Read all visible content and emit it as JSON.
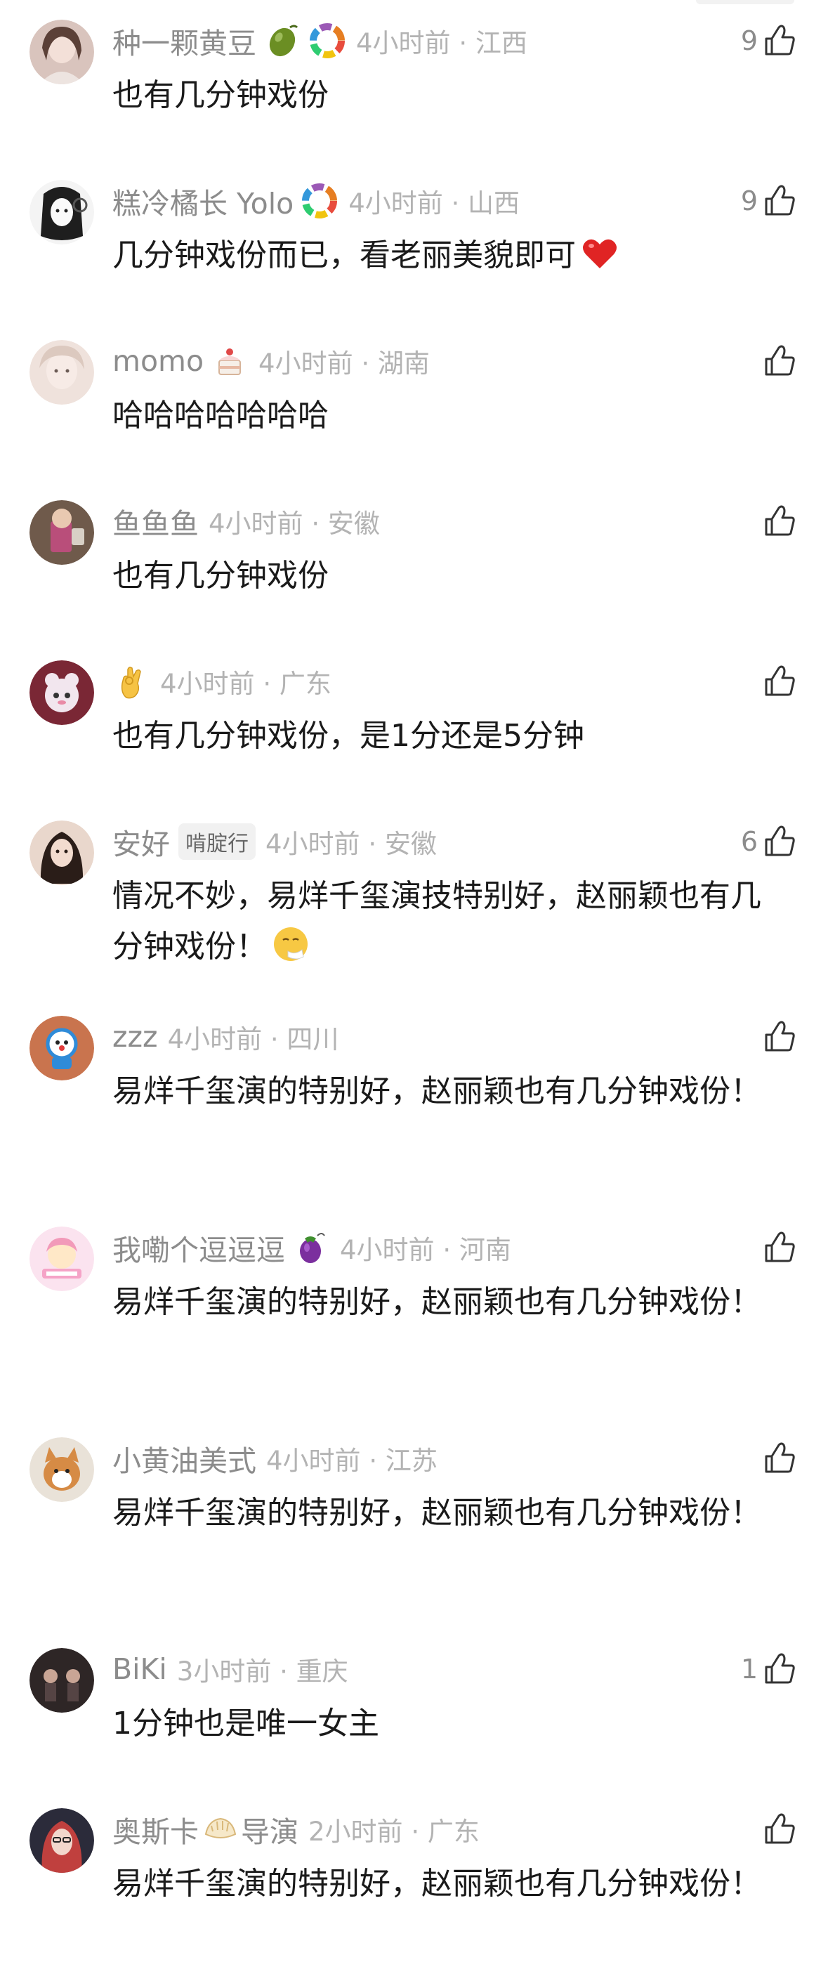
{
  "comments": [
    {
      "username": "种一颗黄豆",
      "badges": [
        "olive-icon",
        "colorful-ring-icon"
      ],
      "time": "4小时前",
      "location": "江西",
      "likes": "9",
      "text": "也有几分钟戏份",
      "avatar_color": "#d9c4bd"
    },
    {
      "username": "糕冷橘长 Yolo",
      "badges": [
        "colorful-ring-icon"
      ],
      "time": "4小时前",
      "location": "山西",
      "likes": "9",
      "text": "几分钟戏份而已，看老丽美貌即可",
      "text_emoji": "red-heart-icon",
      "avatar_color": "#e8e8e8"
    },
    {
      "username": "momo",
      "badges": [
        "cake-icon"
      ],
      "time": "4小时前",
      "location": "湖南",
      "likes": "",
      "text": "哈哈哈哈哈哈哈",
      "avatar_color": "#f0dcd4"
    },
    {
      "username": "鱼鱼鱼",
      "badges": [],
      "time": "4小时前",
      "location": "安徽",
      "likes": "",
      "text": "也有几分钟戏份",
      "avatar_color": "#8a6f5c"
    },
    {
      "username": "",
      "username_emoji": "ok-hand-icon",
      "badges": [],
      "time": "4小时前",
      "location": "广东",
      "likes": "",
      "text": "也有几分钟戏份，是1分还是5分钟",
      "avatar_color": "#b84a5e"
    },
    {
      "username": "安好",
      "badges": [],
      "tag": "啃腚行",
      "time": "4小时前",
      "location": "安徽",
      "likes": "6",
      "text": "情况不妙，易烊千玺演技特别好，赵丽颖也有几分钟戏份！",
      "text_emoji": "sneezing-face-icon",
      "avatar_color": "#3a2a25"
    },
    {
      "username": "zzz",
      "badges": [],
      "time": "4小时前",
      "location": "四川",
      "likes": "",
      "text": "易烊千玺演的特别好，赵丽颖也有几分钟戏份！",
      "avatar_color": "#d27f5a"
    },
    {
      "username": "我嘞个逗逗逗",
      "badges": [
        "eggplant-icon"
      ],
      "time": "4小时前",
      "location": "河南",
      "likes": "",
      "text": "易烊千玺演的特别好，赵丽颖也有几分钟戏份！",
      "avatar_color": "#f5d5e6"
    },
    {
      "username": "小黄油美式",
      "badges": [],
      "time": "4小时前",
      "location": "江苏",
      "likes": "",
      "text": "易烊千玺演的特别好，赵丽颖也有几分钟戏份！",
      "avatar_color": "#d9a46a"
    },
    {
      "username": "BiKi",
      "badges": [],
      "time": "3小时前",
      "location": "重庆",
      "likes": "1",
      "text": "1分钟也是唯一女主",
      "avatar_color": "#3b3030"
    },
    {
      "username": "奥斯卡",
      "username_suffix_emoji": "dumpling-icon",
      "username_suffix": "导演",
      "badges": [],
      "time": "2小时前",
      "location": "广东",
      "likes": "",
      "text": "易烊千玺演的特别好，赵丽颖也有几分钟戏份！",
      "avatar_color": "#c0403e"
    }
  ],
  "separator": "·",
  "like_icon": "thumbs-up-icon",
  "colors": {
    "username": "#8c8c8c",
    "meta": "#b3b3b3",
    "text": "#1a1a1a",
    "background": "#ffffff"
  }
}
